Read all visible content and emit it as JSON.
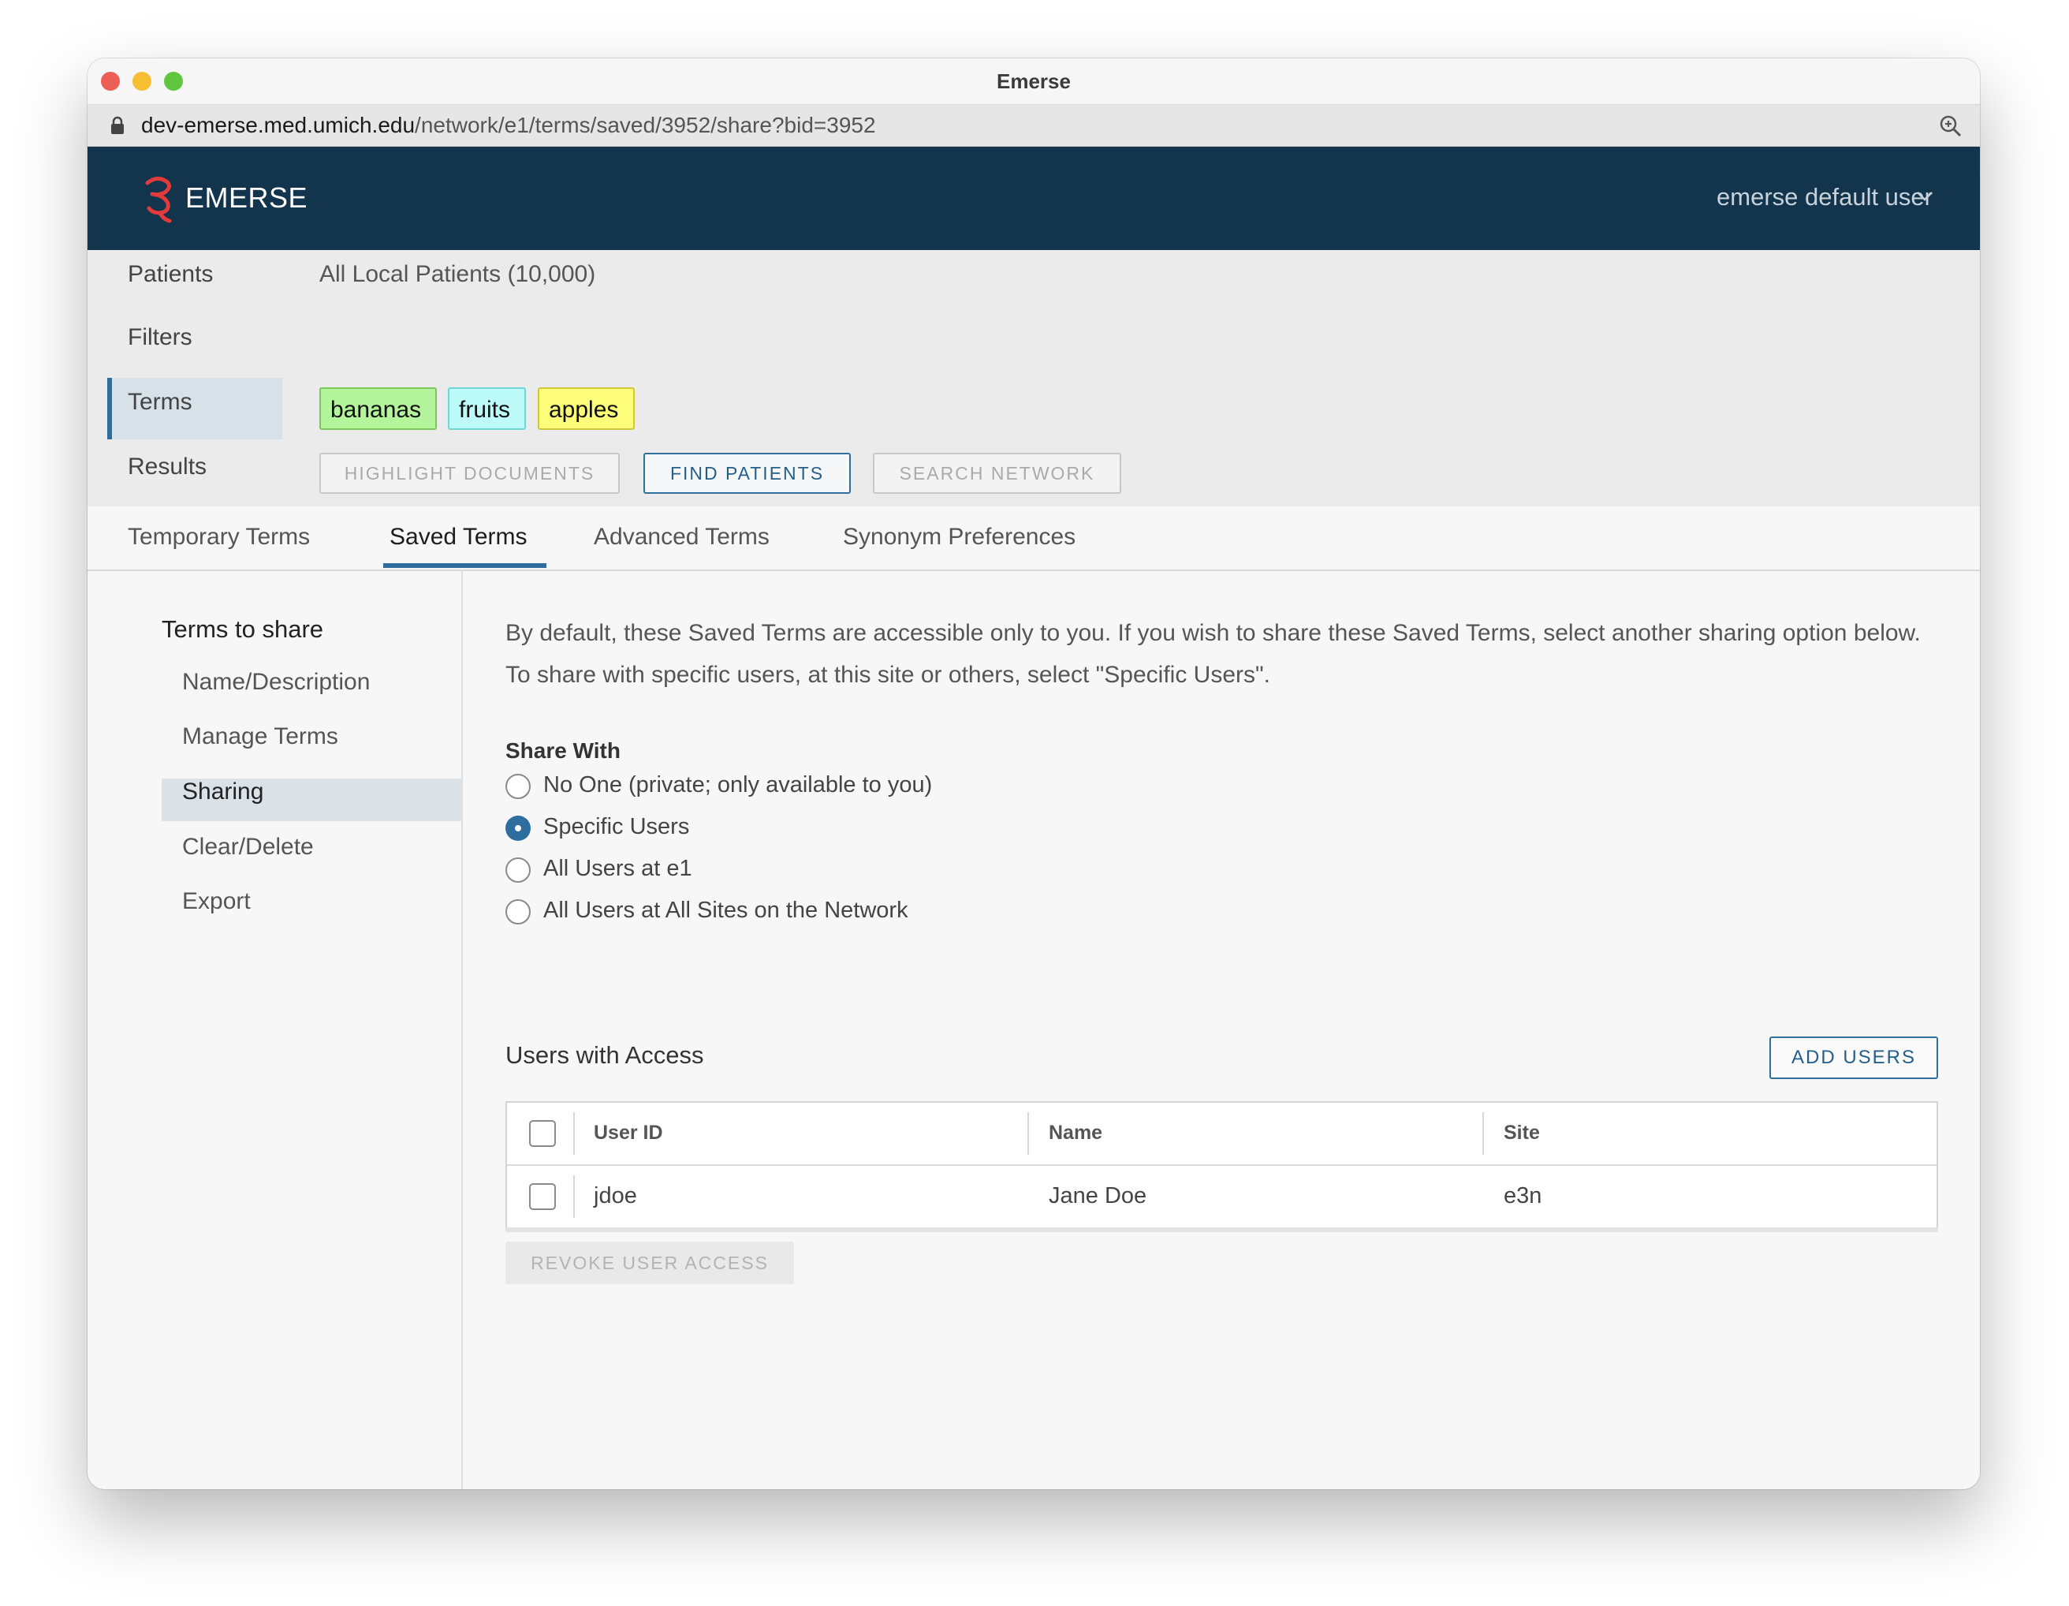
{
  "window": {
    "title": "Emerse"
  },
  "urlbar": {
    "host": "dev-emerse.med.umich.edu",
    "path": "/network/e1/terms/saved/3952/share?bid=3952"
  },
  "header": {
    "logo_text": "EMERSE",
    "user_menu": "emerse default user"
  },
  "query": {
    "rows": {
      "patients_label": "Patients",
      "patients_value": "All Local Patients (10,000)",
      "filters_label": "Filters",
      "terms_label": "Terms",
      "results_label": "Results"
    },
    "terms": [
      {
        "label": "bananas",
        "color": "#b4f59b"
      },
      {
        "label": "fruits",
        "color": "#bdfafa"
      },
      {
        "label": "apples",
        "color": "#fdfd7a"
      }
    ],
    "buttons": {
      "highlight": "HIGHLIGHT DOCUMENTS",
      "find": "FIND PATIENTS",
      "network": "SEARCH NETWORK"
    }
  },
  "tabs": [
    {
      "label": "Temporary Terms",
      "active": false
    },
    {
      "label": "Saved Terms",
      "active": true
    },
    {
      "label": "Advanced Terms",
      "active": false
    },
    {
      "label": "Synonym Preferences",
      "active": false
    }
  ],
  "sidenav": {
    "heading": "Terms to share",
    "items": [
      {
        "label": "Name/Description",
        "active": false
      },
      {
        "label": "Manage Terms",
        "active": false
      },
      {
        "label": "Sharing",
        "active": true
      },
      {
        "label": "Clear/Delete",
        "active": false
      },
      {
        "label": "Export",
        "active": false
      }
    ]
  },
  "sharing": {
    "intro": "By default, these Saved Terms are accessible only to you. If you wish to share these Saved Terms, select another sharing option below. To share with specific users, at this site or others, select \"Specific Users\".",
    "share_with_label": "Share With",
    "options": [
      {
        "label": "No One (private; only available to you)",
        "checked": false
      },
      {
        "label": "Specific Users",
        "checked": true
      },
      {
        "label": "All Users at e1",
        "checked": false
      },
      {
        "label": "All Users at All Sites on the Network",
        "checked": false
      }
    ],
    "users_title": "Users with Access",
    "add_users_label": "ADD USERS",
    "columns": [
      "User ID",
      "Name",
      "Site"
    ],
    "rows": [
      {
        "user_id": "jdoe",
        "name": "Jane Doe",
        "site": "e3n"
      }
    ],
    "revoke_label": "REVOKE USER ACCESS"
  },
  "colors": {
    "header_bg": "#12344c",
    "accent": "#2d6e9e",
    "logo": "#e23b3b"
  }
}
